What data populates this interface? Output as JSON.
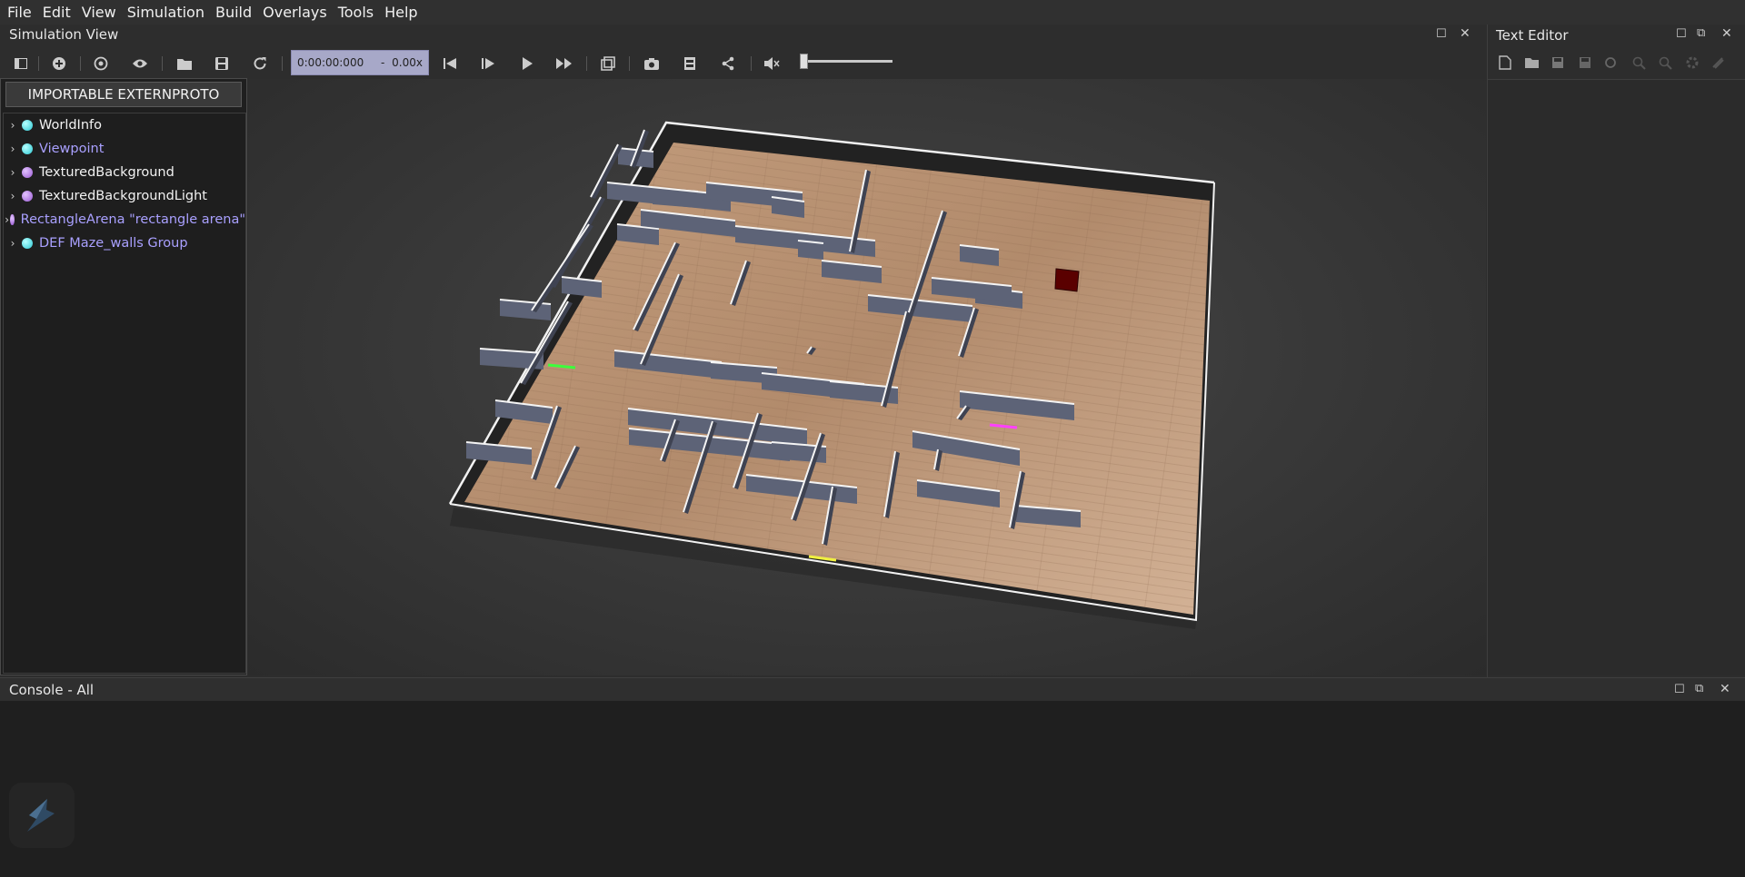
{
  "menu": [
    "File",
    "Edit",
    "View",
    "Simulation",
    "Build",
    "Overlays",
    "Tools",
    "Help"
  ],
  "simulation_view": {
    "title": "Simulation View",
    "time": "0:00:00:000",
    "time_separator": "-",
    "speed": "0.00x",
    "import_button": "IMPORTABLE EXTERNPROTO"
  },
  "scene_tree": {
    "items": [
      {
        "label": "WorldInfo",
        "dot": "cyan",
        "style": "normal"
      },
      {
        "label": "Viewpoint",
        "dot": "cyan",
        "style": "proto"
      },
      {
        "label": "TexturedBackground",
        "dot": "purple",
        "style": "normal"
      },
      {
        "label": "TexturedBackgroundLight",
        "dot": "purple",
        "style": "normal"
      },
      {
        "label": "RectangleArena \"rectangle arena\"",
        "dot": "purple",
        "style": "proto"
      },
      {
        "label": "DEF Maze_walls Group",
        "dot": "cyan",
        "style": "proto"
      }
    ]
  },
  "text_editor": {
    "title": "Text Editor"
  },
  "console": {
    "title": "Console - All"
  },
  "colors": {
    "floor": "#b08a6c",
    "wall_face": "#5d6377",
    "goal_cube": "#5a0000",
    "marker_green": "#3cff3c",
    "marker_magenta": "#ff40ff",
    "marker_yellow": "#f0f040"
  }
}
